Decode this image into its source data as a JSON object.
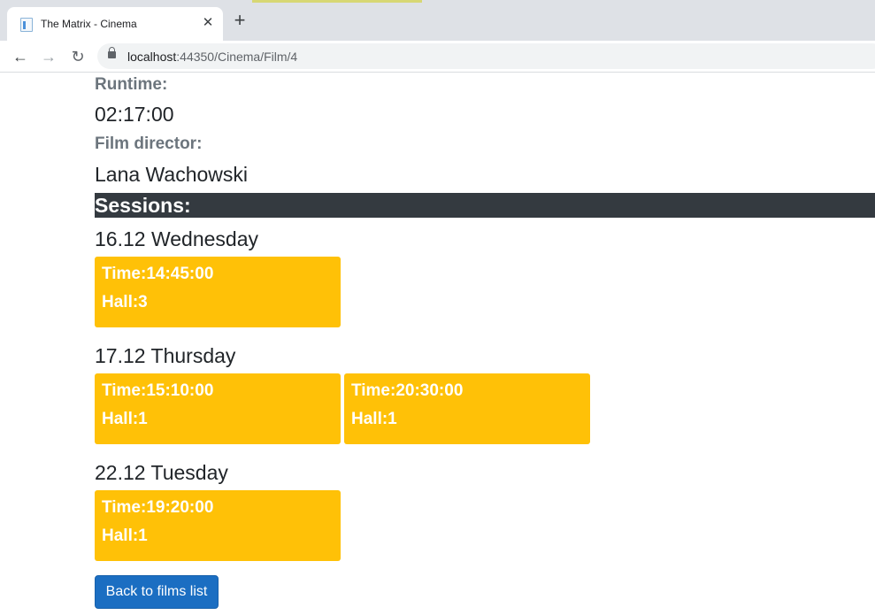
{
  "browser": {
    "tab_title": "The Matrix - Cinema",
    "close_glyph": "✕",
    "newtab_glyph": "+",
    "back_glyph": "←",
    "forward_glyph": "→",
    "reload_glyph": "↻",
    "url_host": "localhost",
    "url_path": ":44350/Cinema/Film/4"
  },
  "film": {
    "runtime_label": "Runtime:",
    "runtime_value": "02:17:00",
    "director_label": "Film director:",
    "director_value": "Lana Wachowski"
  },
  "sessions": {
    "heading": "Sessions:",
    "days": [
      {
        "label": "16.12 Wednesday",
        "items": [
          {
            "time": "Time:14:45:00",
            "hall": "Hall:3"
          }
        ]
      },
      {
        "label": "17.12 Thursday",
        "items": [
          {
            "time": "Time:15:10:00",
            "hall": "Hall:1"
          },
          {
            "time": "Time:20:30:00",
            "hall": "Hall:1"
          }
        ]
      },
      {
        "label": "22.12 Tuesday",
        "items": [
          {
            "time": "Time:19:20:00",
            "hall": "Hall:1"
          }
        ]
      }
    ]
  },
  "actions": {
    "back_label": "Back to films list"
  },
  "colors": {
    "card": "#ffc107",
    "sessions_bar": "#343a40",
    "button": "#1b6ec2",
    "muted_label": "#6c757d"
  }
}
